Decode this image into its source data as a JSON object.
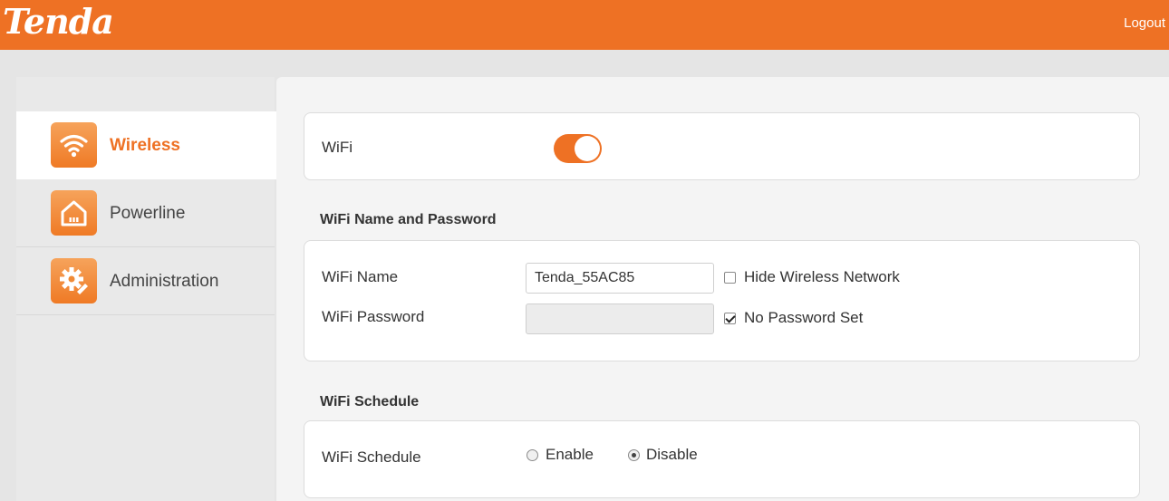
{
  "header": {
    "logo": "Tenda",
    "logout": "Logout"
  },
  "sidebar": {
    "items": [
      {
        "label": "Wireless",
        "icon": "wifi-icon",
        "active": true
      },
      {
        "label": "Powerline",
        "icon": "house-icon",
        "active": false
      },
      {
        "label": "Administration",
        "icon": "gear-icon",
        "active": false
      }
    ]
  },
  "wifi": {
    "label": "WiFi",
    "enabled": true
  },
  "name_password": {
    "title": "WiFi Name and Password",
    "name_label": "WiFi Name",
    "name_value": "Tenda_55AC85",
    "hide_label": "Hide Wireless Network",
    "hide_checked": false,
    "password_label": "WiFi Password",
    "password_value": "",
    "no_password_label": "No Password Set",
    "no_password_checked": true
  },
  "schedule": {
    "title": "WiFi Schedule",
    "label": "WiFi Schedule",
    "enable_label": "Enable",
    "disable_label": "Disable",
    "selected": "Disable"
  },
  "colors": {
    "accent": "#ee7124",
    "background": "#e5e5e5"
  }
}
